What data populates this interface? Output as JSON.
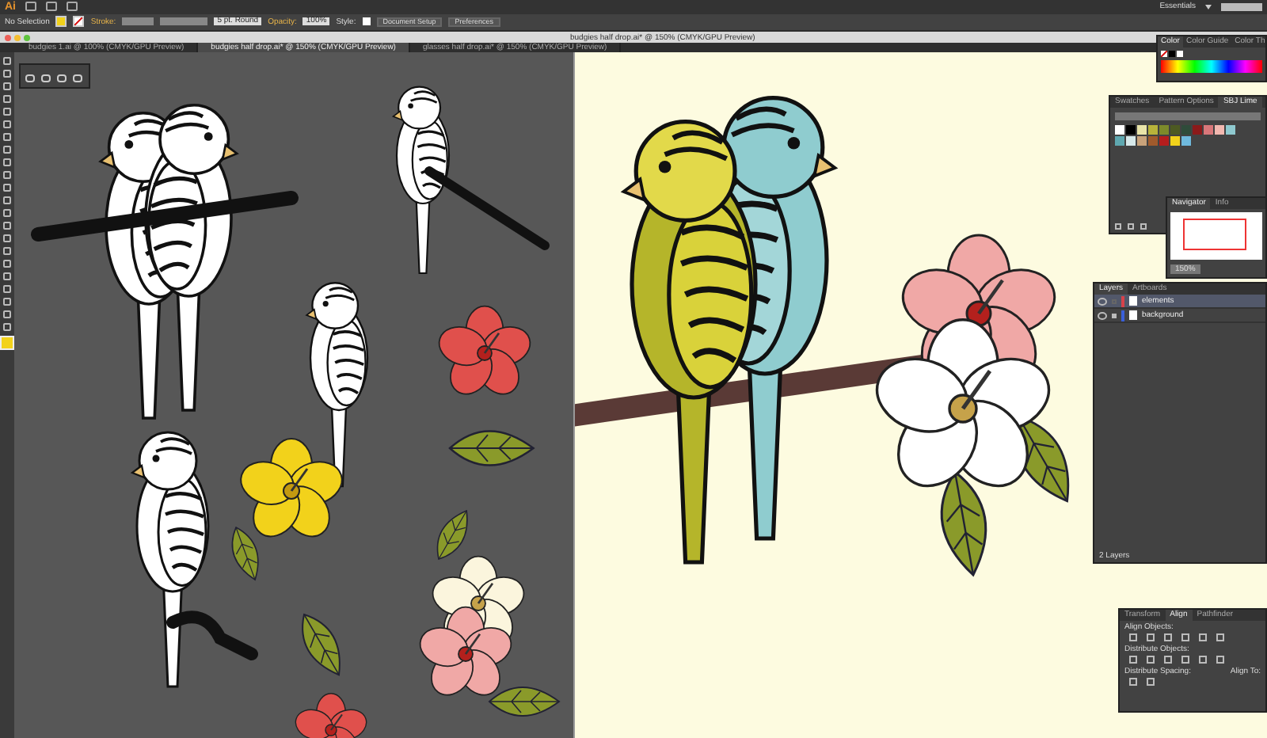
{
  "app": {
    "logo": "Ai",
    "workspace": "Essentials"
  },
  "control_bar": {
    "selection": "No Selection",
    "stroke_label": "Stroke:",
    "brush": "5 pt. Round",
    "opacity_label": "Opacity:",
    "opacity": "100%",
    "style_label": "Style:",
    "buttons": [
      "Document Setup",
      "Preferences"
    ]
  },
  "window": {
    "title": "budgies half drop.ai* @ 150% (CMYK/GPU Preview)"
  },
  "tabs": [
    {
      "label": "budgies 1.ai @ 100% (CMYK/GPU Preview)",
      "selected": false
    },
    {
      "label": "budgies half drop.ai* @ 150% (CMYK/GPU Preview)",
      "selected": true
    },
    {
      "label": "glasses half drop.ai* @ 150% (CMYK/GPU Preview)",
      "selected": false
    }
  ],
  "color_panel": {
    "tabs": [
      {
        "label": "Color",
        "selected": true
      },
      {
        "label": "Color Guide",
        "selected": false
      },
      {
        "label": "Color Th",
        "selected": false
      }
    ]
  },
  "swatches_panel": {
    "tabs": [
      {
        "label": "Swatches",
        "selected": false
      },
      {
        "label": "Pattern Options",
        "selected": false
      },
      {
        "label": "SBJ Lime",
        "selected": true
      }
    ],
    "swatches": [
      {
        "color": "#ffffff"
      },
      {
        "color": "#000000"
      },
      {
        "color": "#e9e4a8"
      },
      {
        "color": "#b8b33a"
      },
      {
        "color": "#7d8a2a"
      },
      {
        "color": "#4d5a22"
      },
      {
        "color": "#2f4b3a"
      },
      {
        "color": "#8b1a1a"
      },
      {
        "color": "#d9777a"
      },
      {
        "color": "#f2b8b0"
      },
      {
        "color": "#8fc9cf"
      },
      {
        "color": "#5fa8b0"
      },
      {
        "color": "#d7e9ea"
      },
      {
        "color": "#c8a27a"
      },
      {
        "color": "#a05a2c"
      },
      {
        "color": "#b51d1d"
      },
      {
        "color": "#f2d21b"
      },
      {
        "color": "#6fb9dd"
      }
    ]
  },
  "navigator_panel": {
    "tabs": [
      {
        "label": "Navigator",
        "selected": true
      },
      {
        "label": "Info",
        "selected": false
      }
    ],
    "zoom": "150%"
  },
  "layers_panel": {
    "tabs": [
      {
        "label": "Layers",
        "selected": true
      },
      {
        "label": "Artboards",
        "selected": false
      }
    ],
    "layers": [
      {
        "name": "elements",
        "color": "#d8424a",
        "selected": true,
        "locked": false
      },
      {
        "name": "background",
        "color": "#3a5fd8",
        "selected": false,
        "locked": true
      }
    ],
    "count": "2 Layers"
  },
  "align_panel": {
    "tabs": [
      {
        "label": "Transform",
        "selected": false
      },
      {
        "label": "Align",
        "selected": true
      },
      {
        "label": "Pathfinder",
        "selected": false
      }
    ],
    "sections": [
      "Align Objects:",
      "Distribute Objects:",
      "Distribute Spacing:"
    ],
    "align_to": "Align To:"
  }
}
